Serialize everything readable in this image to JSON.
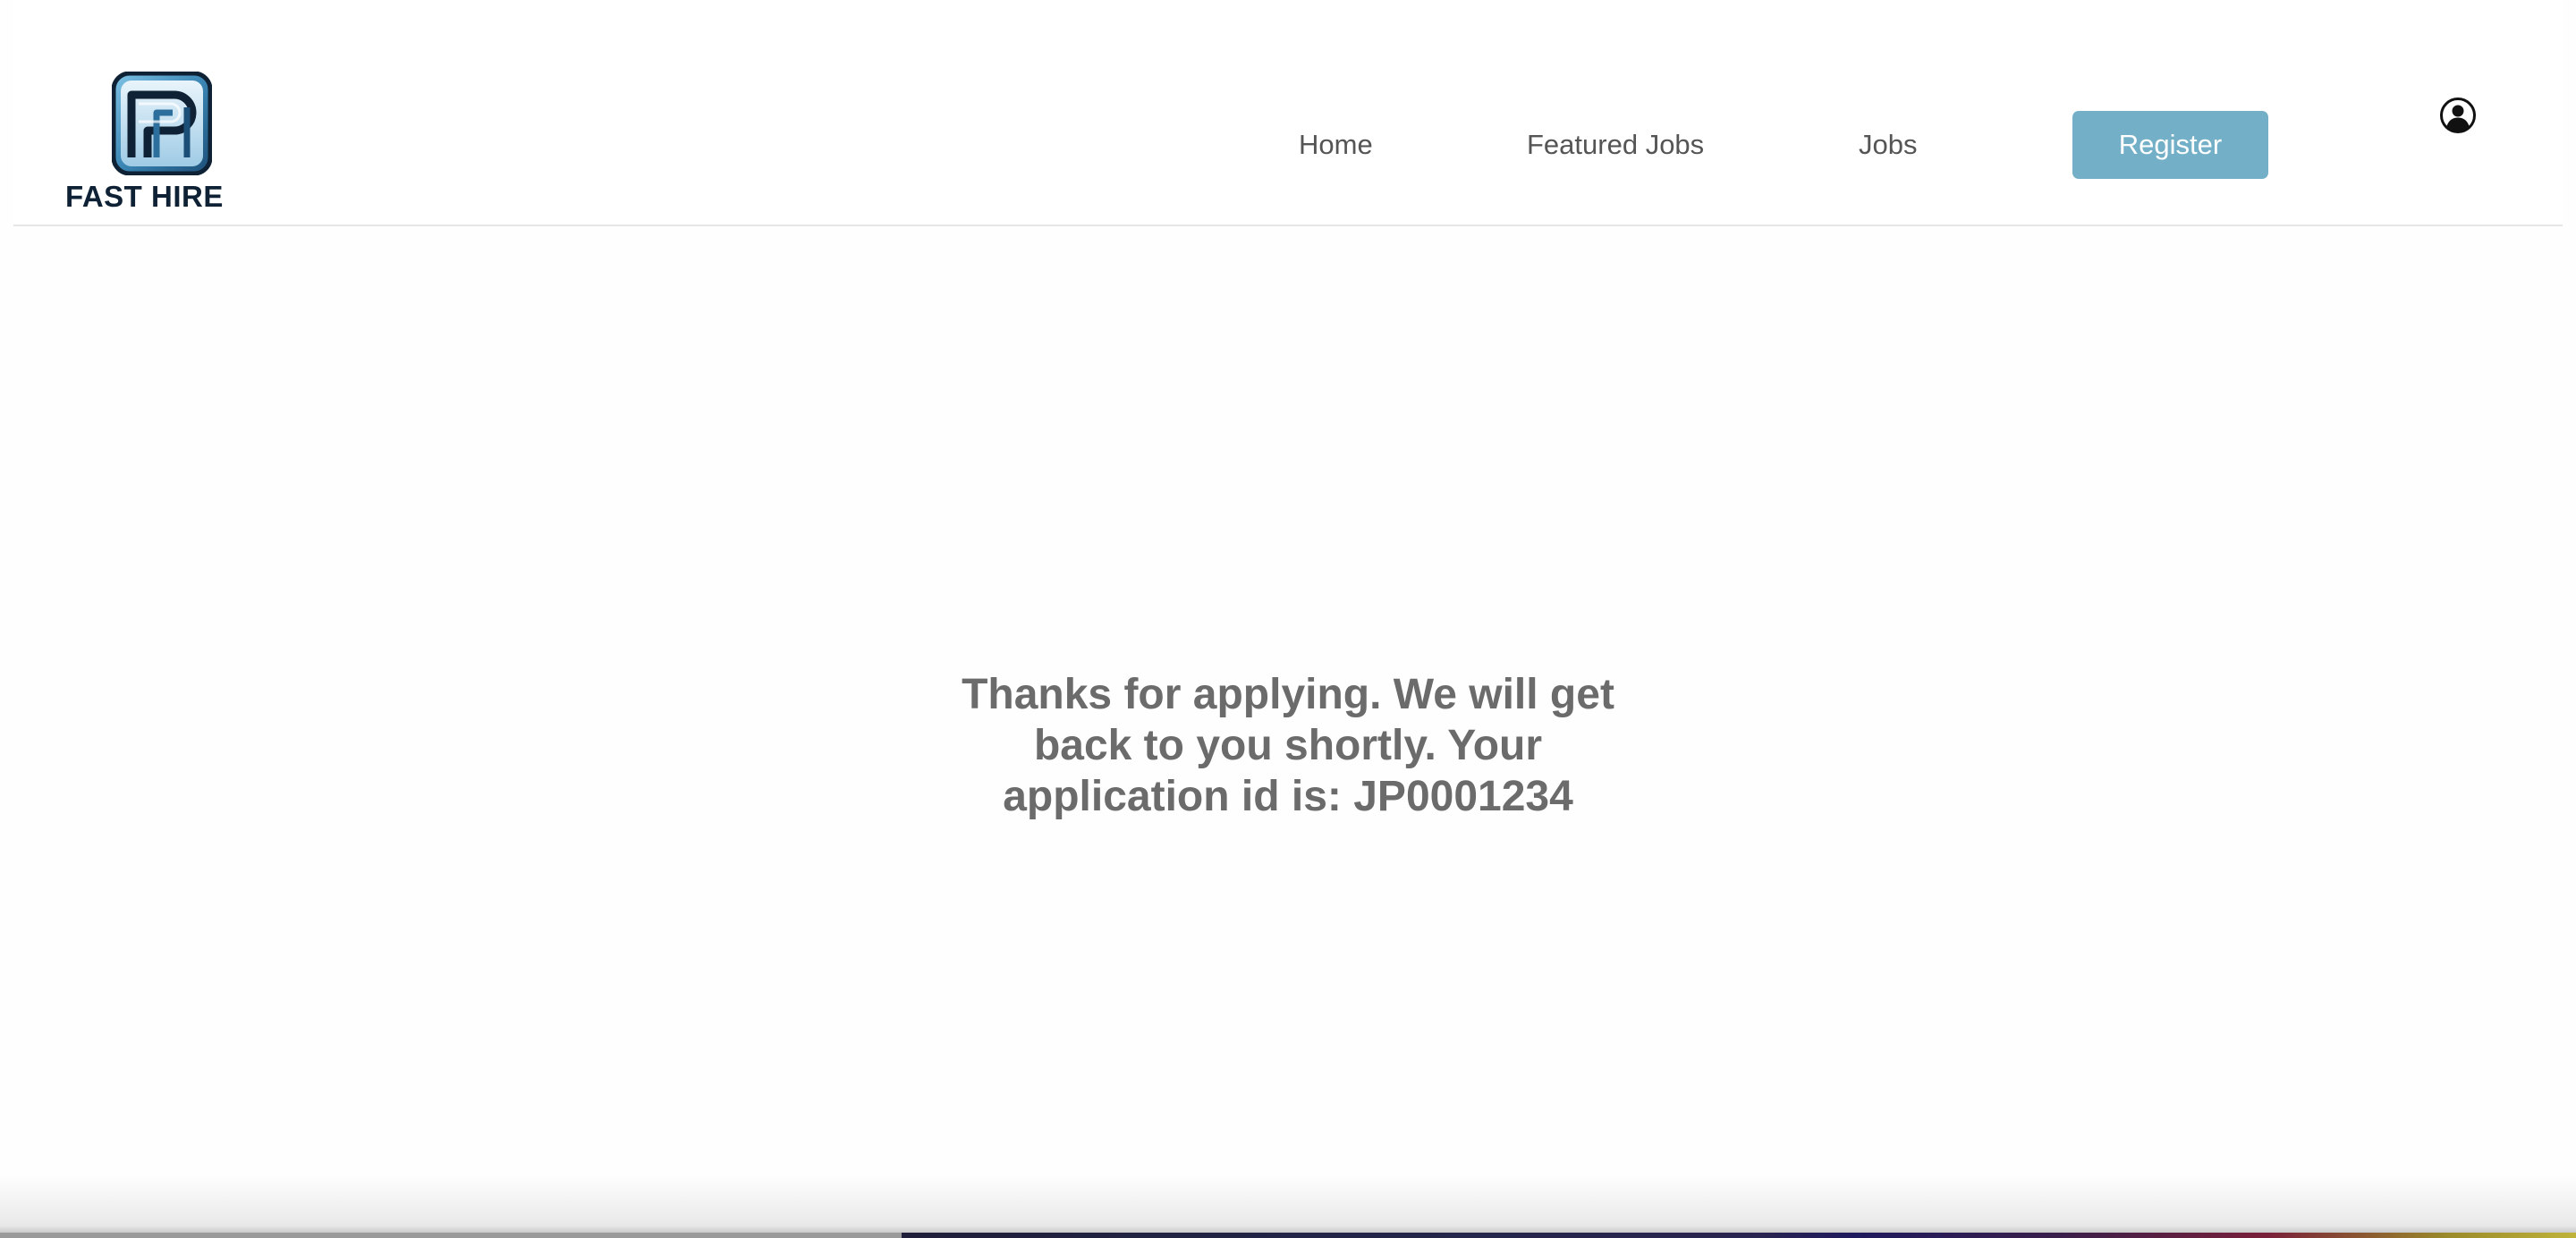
{
  "brand": {
    "name": "FAST HIRE",
    "logo_icon": "fast-hire-logo-icon",
    "colors": {
      "logo_blue": "#3b86b5",
      "logo_dark": "#0f2235"
    }
  },
  "nav": {
    "items": [
      {
        "label": "Home"
      },
      {
        "label": "Featured Jobs"
      },
      {
        "label": "Jobs"
      }
    ],
    "register_label": "Register",
    "register_color": "#73b0c8",
    "profile_icon": "user-circle-icon"
  },
  "main": {
    "message": "Thanks for applying. We will get back to you shortly. Your application id is: JP0001234"
  }
}
